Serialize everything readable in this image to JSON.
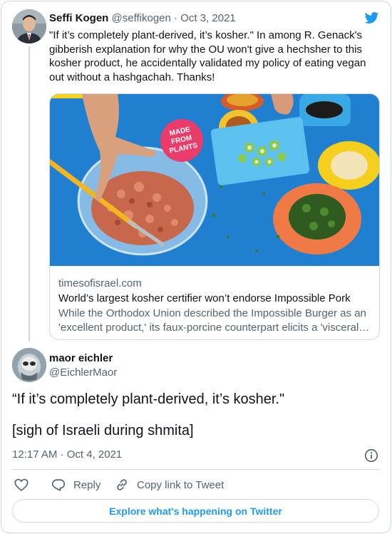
{
  "colors": {
    "twitter_blue": "#1d9bf0",
    "text_primary": "#0f1419",
    "text_secondary": "#536471",
    "border": "#cfd9de"
  },
  "icons": {
    "brand": "twitter-bird-icon",
    "info": "info-icon",
    "like": "heart-icon",
    "reply": "reply-bubble-icon",
    "copy_link": "link-icon"
  },
  "quoted_tweet": {
    "author_name": "Seffi Kogen",
    "author_handle": "@seffikogen",
    "separator": "·",
    "date": "Oct 3, 2021",
    "text": "\"If it’s completely plant-derived, it’s kosher.\" In among R. Genack's gibberish explanation for why the OU won't give a hechsher to this kosher product, he accidentally validated my policy of eating vegan out without a hashgachah. Thanks!",
    "link_card": {
      "badge_text": "MADE FROM PLANTS",
      "domain": "timesofisrael.com",
      "title": "World’s largest kosher certifier won’t endorse Impossible Pork",
      "description_line1": "While the Orthodox Union described the Impossible Burger as an",
      "description_line2": "'excellent product,' its faux-porcine counterpart elicits a 'visceral reaction'"
    }
  },
  "tweet": {
    "author_name": "maor eichler",
    "author_handle": "@EichlerMaor",
    "text_line1": "“If it’s completely plant-derived, it’s kosher.\"",
    "text_line2": "[sigh of Israeli during shmita]",
    "timestamp": "12:17 AM · Oct 4, 2021"
  },
  "actions": {
    "reply_label": "Reply",
    "copy_link_label": "Copy link to Tweet"
  },
  "explore_label": "Explore what's happening on Twitter"
}
